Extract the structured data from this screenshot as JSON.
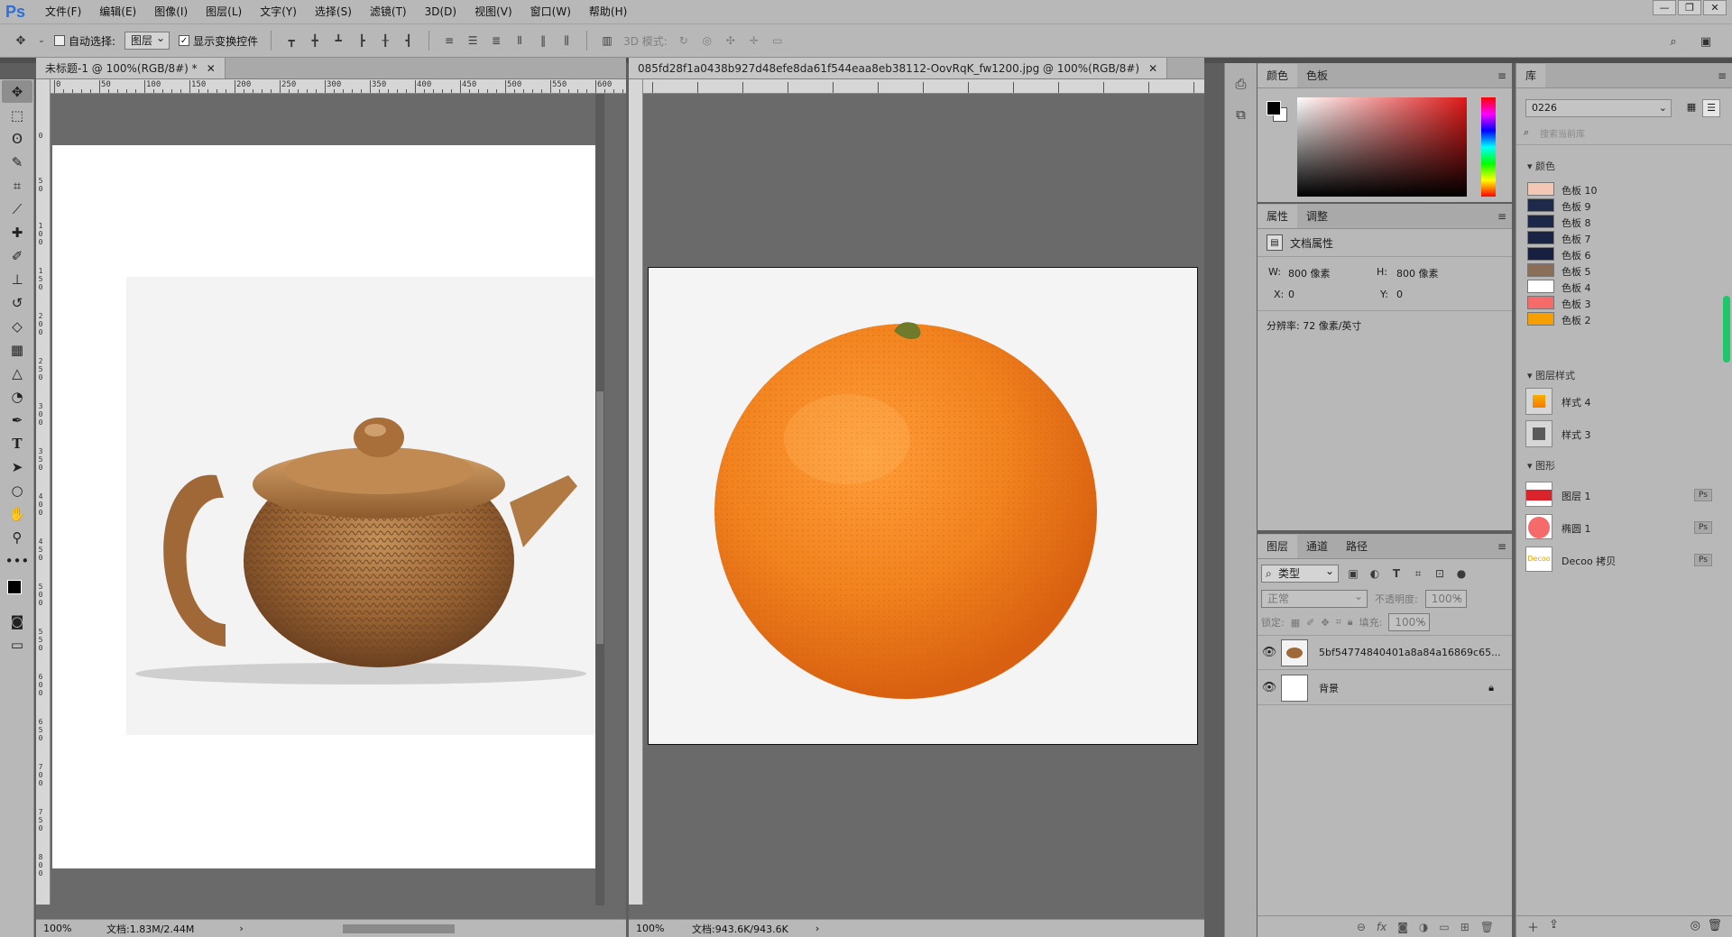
{
  "app": {
    "logo": "Ps"
  },
  "menu": [
    "文件(F)",
    "编辑(E)",
    "图像(I)",
    "图层(L)",
    "文字(Y)",
    "选择(S)",
    "滤镜(T)",
    "3D(D)",
    "视图(V)",
    "窗口(W)",
    "帮助(H)"
  ],
  "window_controls": {
    "minimize": "—",
    "restore": "❐",
    "close": "✕"
  },
  "options": {
    "auto_select_label": "自动选择:",
    "auto_select_value": "图层",
    "show_transform_label": "显示变换控件",
    "mode_3d_label": "3D 模式:"
  },
  "doc1": {
    "tab_title": "未标题-1 @ 100%(RGB/8#) *",
    "zoom": "100%",
    "doc_info": "文档:1.83M/2.44M",
    "ruler_labels": [
      "0",
      "50",
      "100",
      "150",
      "200",
      "250",
      "300",
      "350",
      "400",
      "450",
      "500",
      "550",
      "600"
    ],
    "vruler_labels": [
      "0",
      "50",
      "100",
      "150",
      "200",
      "250",
      "300",
      "350",
      "400",
      "450",
      "500",
      "550",
      "600",
      "650",
      "700",
      "750",
      "800"
    ]
  },
  "doc2": {
    "tab_title": "085fd28f1a0438b927d48efe8da61f544eaa8eb38112-OovRqK_fw1200.jpg @ 100%(RGB/8#)",
    "zoom": "100%",
    "doc_info": "文档:943.6K/943.6K"
  },
  "color_panel": {
    "tabs": [
      "颜色",
      "色板"
    ]
  },
  "properties_panel": {
    "tabs": [
      "属性",
      "调整"
    ],
    "title": "文档属性",
    "w_label": "W:",
    "w_value": "800 像素",
    "h_label": "H:",
    "h_value": "800 像素",
    "x_label": "X:",
    "x_value": "0",
    "y_label": "Y:",
    "y_value": "0",
    "resolution": "分辨率: 72 像素/英寸"
  },
  "layers_panel": {
    "tabs": [
      "图层",
      "通道",
      "路径"
    ],
    "filter_label": "类型",
    "blend_mode": "正常",
    "opacity_label": "不透明度:",
    "opacity_value": "100%",
    "lock_label": "锁定:",
    "fill_label": "填充:",
    "fill_value": "100%",
    "layers": [
      {
        "name": "5bf54774840401a8a84a16869c65...",
        "visible": true,
        "locked": false
      },
      {
        "name": "背景",
        "visible": true,
        "locked": true
      }
    ]
  },
  "library_panel": {
    "tab": "库",
    "library_name": "0226",
    "search_placeholder": "搜索当前库",
    "sections": {
      "colors": "颜色",
      "layer_styles": "图层样式",
      "graphics": "图形"
    },
    "swatches": [
      {
        "name": "色板 10",
        "color": "#f2c8b4"
      },
      {
        "name": "色板 9",
        "color": "#1e2a4c"
      },
      {
        "name": "色板 8",
        "color": "#1c2848"
      },
      {
        "name": "色板 7",
        "color": "#1a2545"
      },
      {
        "name": "色板 6",
        "color": "#172040"
      },
      {
        "name": "色板 5",
        "color": "#8a6e58"
      },
      {
        "name": "色板 4",
        "color": "#ffffff"
      },
      {
        "name": "色板 3",
        "color": "#f56a6a"
      },
      {
        "name": "色板 2",
        "color": "#f5a000"
      }
    ],
    "styles": [
      {
        "name": "样式 4"
      },
      {
        "name": "样式 3"
      }
    ],
    "graphics": [
      {
        "name": "图层 1",
        "badge": "Ps"
      },
      {
        "name": "椭圆 1",
        "badge": "Ps"
      },
      {
        "name": "Decoo 拷贝",
        "badge": "Ps",
        "thumb_text": "Decoo"
      }
    ]
  },
  "colors": {
    "accent_green": "#1fc76a",
    "canvas_gray": "#6a6a6a"
  }
}
